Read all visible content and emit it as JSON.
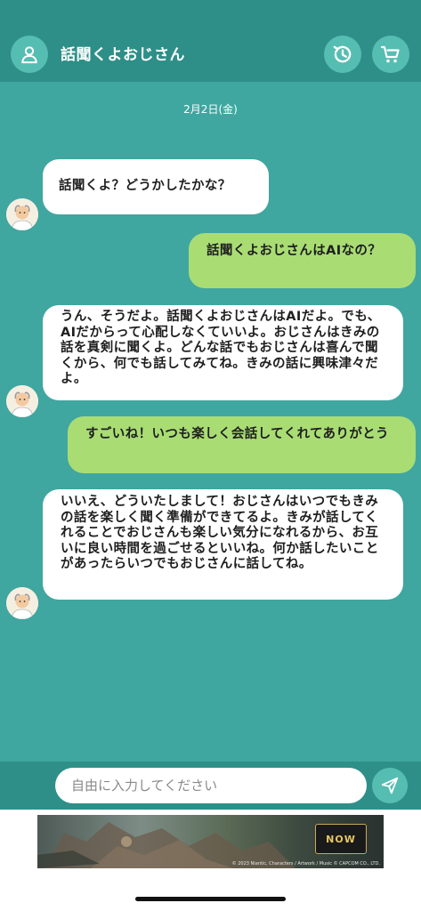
{
  "header": {
    "title": "話聞くよおじさん",
    "profile_icon": "user-icon",
    "history_icon": "history-icon",
    "cart_icon": "cart-icon"
  },
  "chat": {
    "date": "2月2日(金)",
    "messages": [
      {
        "sender": "bot",
        "text": "話聞くよ？どうかしたかな？"
      },
      {
        "sender": "user",
        "text": "話聞くよおじさんはAIなの？"
      },
      {
        "sender": "bot",
        "text": "うん、そうだよ。話聞くよおじさんはAIだよ。でも、AIだからって心配しなくていいよ。おじさんはきみの話を真剣に聞くよ。どんな話でもおじさんは喜んで聞くから、何でも話してみてね。きみの話に興味津々だよ。"
      },
      {
        "sender": "user",
        "text": "すごいね！いつも楽しく会話してくれてありがとう"
      },
      {
        "sender": "bot",
        "text": "いいえ、どういたしまして！おじさんはいつでもきみの話を楽しく聞く準備ができてるよ。きみが話してくれることでおじさんも楽しい気分になれるから、お互いに良い時間を過ごせるといいね。何か話したいことがあったらいつでもおじさんに話してね。"
      }
    ]
  },
  "input": {
    "placeholder": "自由に入力してください",
    "value": "",
    "send_icon": "send-icon"
  },
  "ad": {
    "logo_text": "NOW",
    "credit": "© 2023 Niantic, Characters / Artwork / Music © CAPCOM CO., LTD."
  },
  "colors": {
    "header": "#2e8f88",
    "chat_bg": "#40a6a0",
    "icon_circle": "#56bdb2",
    "bot_bubble": "#ffffff",
    "user_bubble": "#a9dd74"
  }
}
